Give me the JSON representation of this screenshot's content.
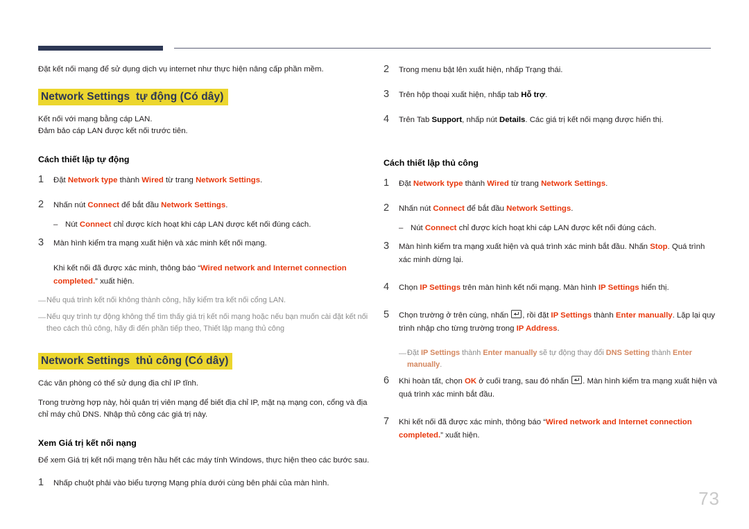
{
  "document": {
    "page_number": "73",
    "colors": {
      "accent_red": "#e8380d",
      "highlight_yellow": "#ecd62e",
      "heading_navy": "#2d3754",
      "note_gray": "#8c8c8c"
    }
  },
  "left_column": {
    "intro": "Đặt kết nối mạng để sử dụng dịch vụ internet như thực hiện nâng cấp phần mềm.",
    "section_auto": {
      "heading": "Network Settings  tự động (Có dây)",
      "line1": "Kết nối với mạng bằng cáp LAN.",
      "line2": "Đảm bảo cáp LAN được kết nối trước tiên.",
      "sub_heading": "Cách thiết lập tự động",
      "step1": {
        "num": "1",
        "t1": "Đặt ",
        "kw1": "Network type",
        "t2": " thành ",
        "kw2": "Wired",
        "t3": " từ trang ",
        "kw3": "Network Settings",
        "t4": "."
      },
      "step2": {
        "num": "2",
        "t1": "Nhấn nút ",
        "kw1": "Connect",
        "t2": " để bắt đầu ",
        "kw2": "Network Settings",
        "t3": "."
      },
      "step2_dash": {
        "dash": "‒",
        "t1": "Nút ",
        "kw1": "Connect",
        "t2": " chỉ được kích hoạt khi cáp LAN được kết nối đúng cách."
      },
      "step3": {
        "num": "3",
        "t1": "Màn hình kiểm tra mạng xuất hiện và xác minh kết nối mạng."
      },
      "step3_detail": {
        "t1": "Khi kết nối đã được xác minh, thông báo “",
        "kw1": "Wired network and Internet connection completed.",
        "t2": "” xuất hiện."
      },
      "note1": "Nếu quá trình kết nối không thành công, hãy kiểm tra kết nối cổng LAN.",
      "note2": "Nếu quy trình tự động không thể tìm thấy giá trị kết nối mạng hoặc nếu bạn muốn cài đặt kết nối theo cách thủ công, hãy đi đến phần tiếp theo, Thiết lập mạng thủ công"
    },
    "section_manual": {
      "heading": "Network Settings  thủ công (Có dây)",
      "line1": "Các văn phòng có thể sử dụng địa chỉ IP tĩnh.",
      "line2": "Trong trường hợp này, hỏi quản trị viên mạng để biết địa chỉ IP, mặt nạ mạng con, cổng và địa chỉ máy chủ DNS. Nhập thủ công các giá trị này.",
      "sub_heading": "Xem Giá trị kết nối nạng",
      "intro": "Để xem Giá trị kết nối mạng trên hầu hết các máy tính Windows, thực hiện theo các bước sau.",
      "step1": {
        "num": "1",
        "t1": "Nhấp chuột phải vào biểu tượng Mạng phía dưới cùng bên phải của màn hình."
      }
    }
  },
  "right_column": {
    "step2": {
      "num": "2",
      "t1": "Trong menu bật lên xuất hiện, nhấp Trạng thái."
    },
    "step3": {
      "num": "3",
      "t1": "Trên hộp thoại xuất hiện, nhấp tab ",
      "bk1": "Hỗ trợ",
      "t2": "."
    },
    "step4": {
      "num": "4",
      "t1": "Trên Tab ",
      "bk1": "Support",
      "t2": ", nhấp nút ",
      "bk2": "Details",
      "t3": ". Các giá trị kết nối mạng được hiển thị."
    },
    "sub_heading": "Cách thiết lập thủ công",
    "m_step1": {
      "num": "1",
      "t1": "Đặt ",
      "kw1": "Network type",
      "t2": " thành ",
      "kw2": "Wired",
      "t3": " từ trang ",
      "kw3": "Network Settings",
      "t4": "."
    },
    "m_step2": {
      "num": "2",
      "t1": "Nhấn nút ",
      "kw1": "Connect",
      "t2": " để bắt đầu ",
      "kw2": "Network Settings",
      "t3": "."
    },
    "m_step2_dash": {
      "dash": "‒",
      "t1": "Nút ",
      "kw1": "Connect",
      "t2": " chỉ được kích hoạt khi cáp LAN được kết nối đúng cách."
    },
    "m_step3": {
      "num": "3",
      "t1": "Màn hình kiểm tra mạng xuất hiện và quá trình xác minh bắt đầu. Nhấn ",
      "kw1": "Stop",
      "t2": ". Quá trình xác minh dừng lại."
    },
    "m_step4": {
      "num": "4",
      "t1": "Chọn ",
      "kw1": "IP Settings",
      "t2": " trên màn hình kết nối mạng. Màn hình ",
      "kw2": "IP Settings",
      "t3": " hiển thị."
    },
    "m_step5": {
      "num": "5",
      "t1": "Chọn trường ở trên cùng, nhấn ",
      "icon": "enter-key-icon",
      "t2": ", rồi đặt ",
      "kw1": "IP Settings",
      "t3": " thành ",
      "kw2": "Enter manually",
      "t4": ". Lặp lại quy trình nhập cho từng trường trong ",
      "kw3": "IP Address",
      "t5": "."
    },
    "m_note": {
      "t1": "Đặt ",
      "kw1": "IP Settings",
      "t2": " thành ",
      "kw2": "Enter manually",
      "t3": " sẽ tự động thay đổi ",
      "kw3": "DNS Setting",
      "t4": " thành ",
      "kw4": "Enter manually",
      "t5": "."
    },
    "m_step6": {
      "num": "6",
      "t1": "Khi hoàn tất, chọn ",
      "kw1": "OK",
      "t2": " ở cuối trang, sau đó nhấn ",
      "icon": "enter-key-icon",
      "t3": ". Màn hình kiểm tra mạng xuất hiện và quá trình xác minh bắt đầu."
    },
    "m_step7": {
      "num": "7",
      "t1": "Khi kết nối đã được xác minh, thông báo “",
      "kw1": "Wired network and Internet connection completed.",
      "t2": "” xuất hiện."
    }
  }
}
